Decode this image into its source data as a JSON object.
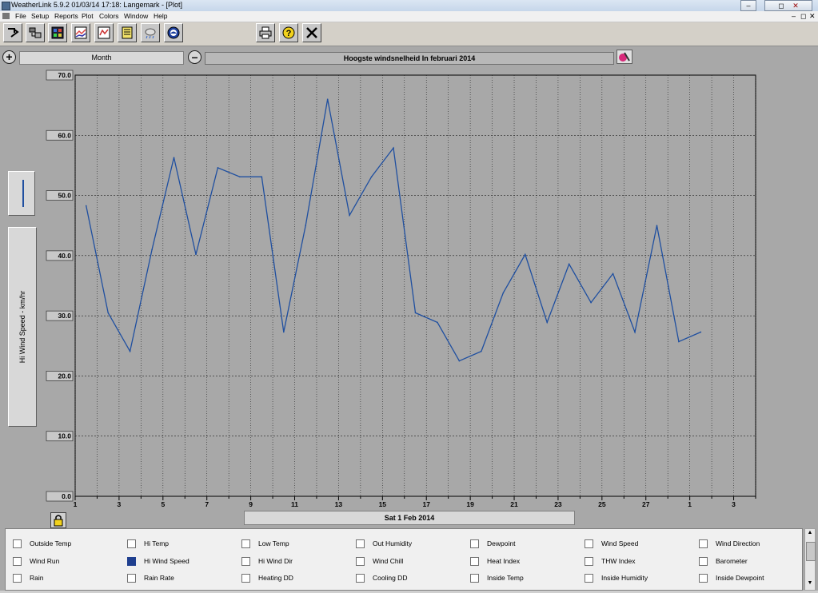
{
  "window": {
    "title": "WeatherLink 5.9.2  01/03/14  17:18: Langemark - [Plot]"
  },
  "menu": [
    "File",
    "Setup",
    "Reports",
    "Plot",
    "Colors",
    "Window",
    "Help"
  ],
  "toolbar": {
    "icons": [
      "select-station-icon",
      "download-icon",
      "bulletin-icon",
      "plot-icon",
      "strip-chart-icon",
      "notebook-icon",
      "weather-icon",
      "noaa-icon",
      "print-icon",
      "help-icon",
      "close-icon"
    ]
  },
  "controls": {
    "period": "Month",
    "plot_title": "Hoogste windsnelheid  In februari 2014"
  },
  "chart": {
    "y_axis_label": "Hi Wind Speed - km/hr",
    "date_label": "Sat 1 Feb 2014",
    "line_color": "#1f4fa0"
  },
  "chart_data": {
    "type": "line",
    "ylim": [
      0,
      70
    ],
    "xlim": [
      1,
      32
    ],
    "yticks": [
      "0.0",
      "10.0",
      "20.0",
      "30.0",
      "40.0",
      "50.0",
      "60.0",
      "70.0"
    ],
    "xtick_labels": [
      "1",
      "3",
      "5",
      "7",
      "9",
      "11",
      "13",
      "15",
      "17",
      "19",
      "21",
      "23",
      "25",
      "27",
      "1",
      "3"
    ],
    "grid": true,
    "x": [
      1.5,
      2.5,
      3.5,
      4.5,
      5.5,
      6.5,
      7.5,
      8.5,
      9.5,
      10.5,
      11.5,
      12.5,
      13.5,
      14.5,
      15.5,
      16.5,
      17.5,
      18.5,
      19.5,
      20.5,
      21.5,
      22.5,
      23.5,
      24.5,
      25.5,
      26.5,
      27.5,
      28.5,
      29.5
    ],
    "values": [
      48.3,
      30.5,
      24.1,
      41.0,
      56.3,
      40.2,
      54.6,
      53.1,
      53.1,
      27.3,
      45.0,
      66.0,
      46.7,
      53.1,
      57.9,
      30.5,
      28.9,
      22.5,
      24.1,
      33.8,
      40.2,
      28.9,
      38.6,
      32.2,
      37.0,
      27.3,
      45.0,
      25.7,
      27.3
    ]
  },
  "checkboxes": [
    [
      {
        "label": "Outside Temp",
        "checked": false
      },
      {
        "label": "Hi Temp",
        "checked": false
      },
      {
        "label": "Low Temp",
        "checked": false
      },
      {
        "label": "Out Humidity",
        "checked": false
      },
      {
        "label": "Dewpoint",
        "checked": false
      },
      {
        "label": "Wind Speed",
        "checked": false
      },
      {
        "label": "Wind Direction",
        "checked": false
      }
    ],
    [
      {
        "label": "Wind Run",
        "checked": false
      },
      {
        "label": "Hi Wind Speed",
        "checked": true
      },
      {
        "label": "Hi Wind Dir",
        "checked": false
      },
      {
        "label": "Wind Chill",
        "checked": false
      },
      {
        "label": "Heat Index",
        "checked": false
      },
      {
        "label": "THW Index",
        "checked": false
      },
      {
        "label": "Barometer",
        "checked": false
      }
    ],
    [
      {
        "label": "Rain",
        "checked": false
      },
      {
        "label": "Rain Rate",
        "checked": false
      },
      {
        "label": "Heating DD",
        "checked": false
      },
      {
        "label": "Cooling DD",
        "checked": false
      },
      {
        "label": "Inside Temp",
        "checked": false
      },
      {
        "label": "Inside Humidity",
        "checked": false
      },
      {
        "label": "Inside Dewpoint",
        "checked": false
      }
    ]
  ]
}
